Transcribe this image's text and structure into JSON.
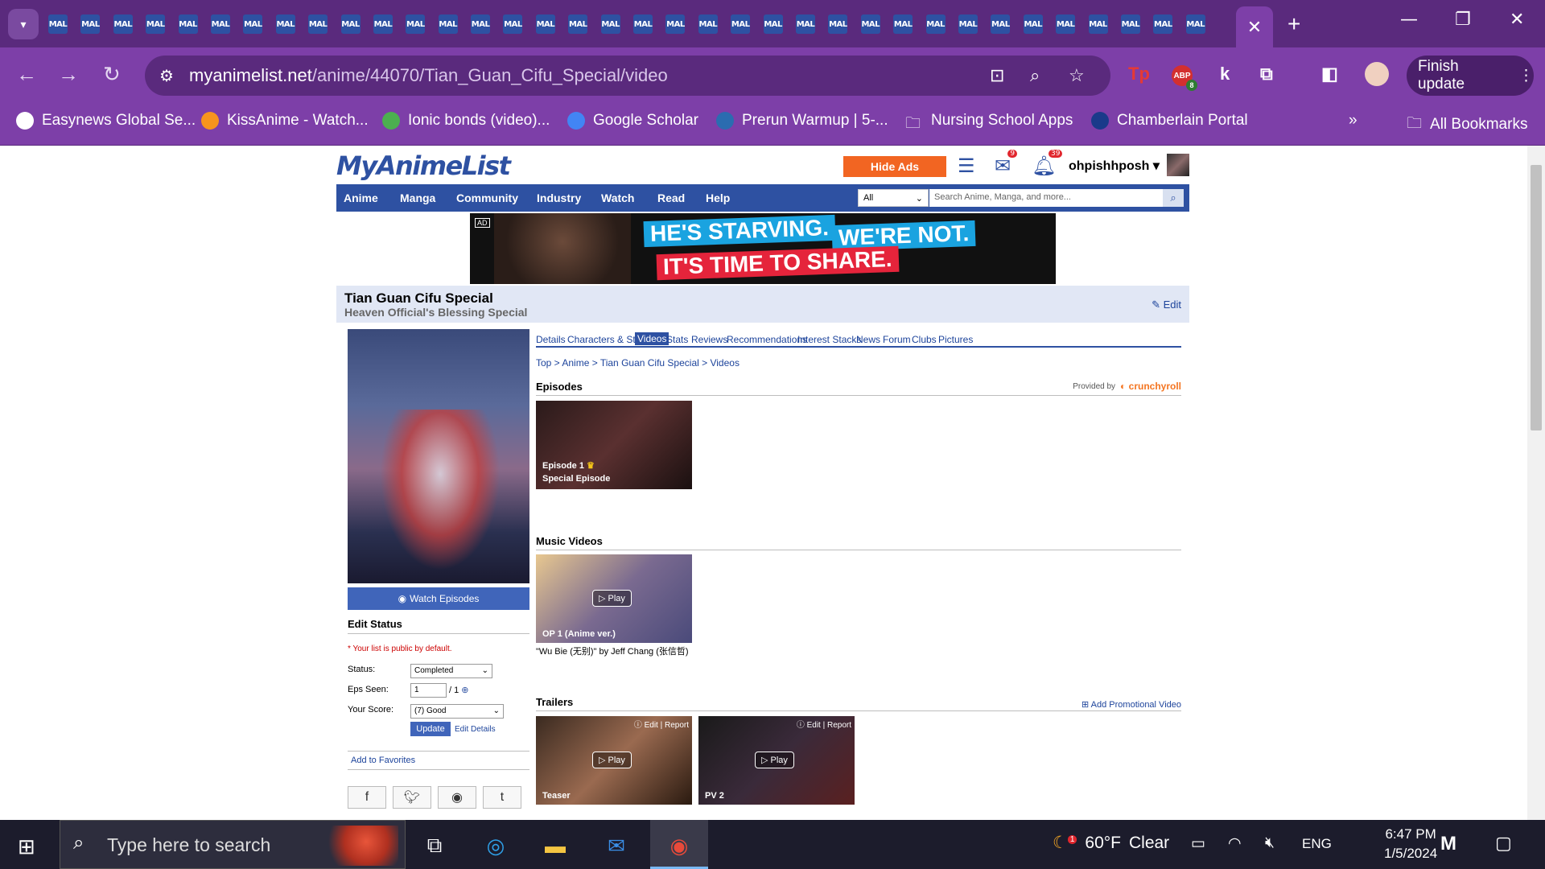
{
  "browser": {
    "tab_favicon": "MAL",
    "tab_count": 36,
    "url_host": "myanimelist.net",
    "url_path": "/anime/44070/Tian_Guan_Cifu_Special/video",
    "finish_update": "Finish update",
    "ext_badge": "8",
    "bookmarks": [
      "Easynews Global Se...",
      "KissAnime - Watch...",
      "Ionic bonds (video)...",
      "Google Scholar",
      "Prerun Warmup | 5-...",
      "Nursing School Apps",
      "Chamberlain Portal"
    ],
    "all_bookmarks": "All Bookmarks",
    "accent": "#7d3fa8"
  },
  "mal": {
    "logo": "MyAnimeList",
    "hide_ads": "Hide Ads",
    "msg_badge": "9",
    "notif_badge": "39",
    "username": "ohpishhposh",
    "menu": [
      "Anime",
      "Manga",
      "Community",
      "Industry",
      "Watch",
      "Read",
      "Help"
    ],
    "search_scope": "All",
    "search_placeholder": "Search Anime, Manga, and more...",
    "ad": {
      "tag": "AD",
      "line1": "HE'S STARVING.",
      "line2": "WE'RE NOT.",
      "line3": "IT'S TIME TO SHARE."
    },
    "title": "Tian Guan Cifu Special",
    "title_alt": "Heaven Official's Blessing Special",
    "edit": "Edit",
    "subnav": [
      "Details",
      "Characters & Staff",
      "Videos",
      "Stats",
      "Reviews",
      "Recommendations",
      "Interest Stacks",
      "News",
      "Forum",
      "Clubs",
      "Pictures"
    ],
    "breadcrumb": "Top  >  Anime  >  Tian Guan Cifu Special  >  Videos",
    "episodes_header": "Episodes",
    "provided_by": "Provided by",
    "provider": "crunchyroll",
    "episode": {
      "label": "Episode 1",
      "sub": "Special Episode"
    },
    "music_header": "Music Videos",
    "play": "Play",
    "mv": {
      "caption": "OP 1 (Anime ver.)",
      "desc": "\"Wu Bie (无别)\" by Jeff Chang (张信哲)"
    },
    "trailers_header": "Trailers",
    "add_promo": "Add Promotional Video",
    "trailer_controls": "Edit | Report",
    "trailers": [
      "Teaser",
      "PV 2"
    ],
    "watch_episodes": "Watch Episodes",
    "edit_status": "Edit Status",
    "public_note": "* Your list is public by default.",
    "status_label": "Status:",
    "status_value": "Completed",
    "eps_label": "Eps Seen:",
    "eps_value": "1",
    "eps_total": "/ 1",
    "score_label": "Your Score:",
    "score_value": "(7) Good",
    "update": "Update",
    "edit_details": "Edit Details",
    "add_favorites": "Add to Favorites",
    "brand": "#2e51a2"
  },
  "taskbar": {
    "search": "Type here to search",
    "weather_badge": "1",
    "temp": "60°F",
    "condition": "Clear",
    "lang": "ENG",
    "time": "6:47 PM",
    "date": "1/5/2024"
  }
}
